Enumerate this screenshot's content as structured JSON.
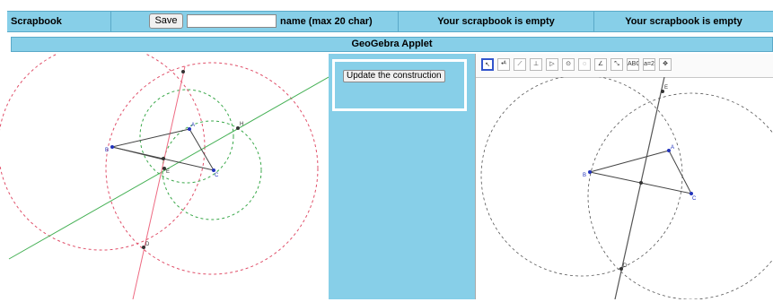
{
  "scrapbook": {
    "title": "Scrapbook",
    "save_label": "Save",
    "name_field_value": "",
    "name_label": "name (max 20 char)",
    "slot1": "Your scrapbook is empty",
    "slot2": "Your scrapbook is empty"
  },
  "applet": {
    "title": "GeoGebra Applet",
    "update_button": "Update the construction"
  },
  "left_canvas": {
    "labels": {
      "A": "A",
      "B": "B",
      "C": "C",
      "D": "D",
      "E": "E",
      "H": "H"
    }
  },
  "right_canvas": {
    "labels": {
      "A": "A",
      "B": "B",
      "C": "C",
      "D": "D",
      "E": "E"
    }
  },
  "toolbar": {
    "tools": [
      "move-tool",
      "point-tool",
      "line-tool",
      "perpendicular-tool",
      "polygon-tool",
      "circle-center-tool",
      "circle-three-points-tool",
      "angle-tool",
      "reflect-tool",
      "text-tool",
      "slider-tool",
      "move-view-tool"
    ],
    "text_tool_label": "ABC",
    "slider_tool_label": "a=2"
  }
}
